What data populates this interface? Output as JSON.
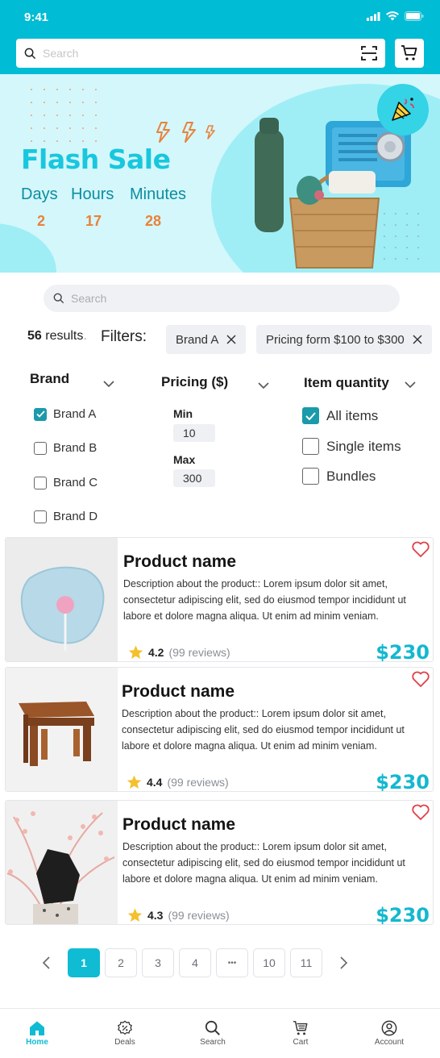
{
  "status": {
    "time": "9:41"
  },
  "header": {
    "search_placeholder": "Search"
  },
  "banner": {
    "title": "Flash Sale",
    "countdown": [
      {
        "label": "Days",
        "value": "2"
      },
      {
        "label": "Hours",
        "value": "17"
      },
      {
        "label": "Minutes",
        "value": "28"
      }
    ]
  },
  "search": {
    "placeholder": "Search"
  },
  "results": {
    "count": "56",
    "suffix": "results"
  },
  "filters": {
    "label": "Filters:",
    "chips": [
      "Brand A",
      "Pricing form $100 to $300"
    ]
  },
  "brand": {
    "title": "Brand",
    "options": [
      {
        "label": "Brand A",
        "checked": true
      },
      {
        "label": "Brand B",
        "checked": false
      },
      {
        "label": "Brand C",
        "checked": false
      },
      {
        "label": "Brand D",
        "checked": false
      }
    ]
  },
  "pricing": {
    "title": "Pricing ($)",
    "min_label": "Min",
    "min_value": "10",
    "max_label": "Max",
    "max_value": "300"
  },
  "quantity": {
    "title": "Item quantity",
    "options": [
      {
        "label": "All items",
        "checked": true
      },
      {
        "label": "Single items",
        "checked": false
      },
      {
        "label": "Bundles",
        "checked": false
      }
    ]
  },
  "products": [
    {
      "name": "Product name",
      "description": "Description about the product:: Lorem ipsum dolor sit amet, consectetur adipiscing elit, sed do eiusmod tempor incididunt ut labore et dolore magna aliqua. Ut enim ad minim veniam.",
      "rating": "4.2",
      "reviews": "(99 reviews)",
      "price": "$230"
    },
    {
      "name": "Product name",
      "description": "Description about the product:: Lorem ipsum dolor sit amet, consectetur adipiscing elit, sed do eiusmod tempor incididunt ut labore et dolore magna aliqua. Ut enim ad minim veniam.",
      "rating": "4.4",
      "reviews": "(99 reviews)",
      "price": "$230"
    },
    {
      "name": "Product name",
      "description": "Description about the product:: Lorem ipsum dolor sit amet, consectetur adipiscing elit, sed do eiusmod tempor incididunt ut labore et dolore magna aliqua. Ut enim ad minim veniam.",
      "rating": "4.3",
      "reviews": "(99 reviews)",
      "price": "$230"
    }
  ],
  "pagination": {
    "pages": [
      "1",
      "2",
      "3",
      "4",
      "•••",
      "10",
      "11"
    ],
    "current": "1"
  },
  "nav": {
    "items": [
      {
        "label": "Home",
        "icon": "home-icon"
      },
      {
        "label": "Deals",
        "icon": "deals-icon"
      },
      {
        "label": "Search",
        "icon": "search-icon"
      },
      {
        "label": "Cart",
        "icon": "cart-icon"
      },
      {
        "label": "Account",
        "icon": "account-icon"
      }
    ]
  },
  "colors": {
    "primary": "#00bcd4",
    "accent": "#e8823a",
    "price": "#14b8cf",
    "heart": "#e0404a"
  }
}
